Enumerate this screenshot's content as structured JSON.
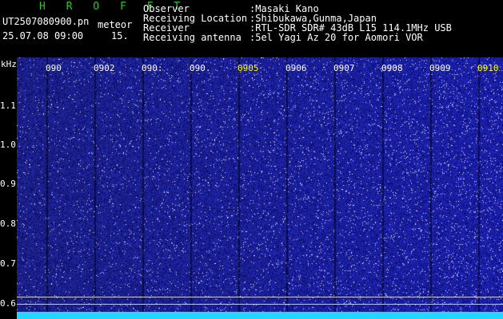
{
  "header": {
    "title": "H R O F F T",
    "file_name": "UT2507080900.pn",
    "mode_label": "meteor",
    "datetime": "25.07.08 09:00",
    "interval": "15.",
    "fields": [
      {
        "label": "Observer",
        "value": ":Masaki Kano"
      },
      {
        "label": "Receiving Location",
        "value": ":Shibukawa,Gunma,Japan"
      },
      {
        "label": "Receiver",
        "value": ":RTL-SDR SDR# 43dB L15 114.1MHz USB"
      },
      {
        "label": "Receiving antenna",
        "value": ":5el Yagi Az 20 for Aomori VOR"
      }
    ]
  },
  "y_axis": {
    "unit": "kHz",
    "ticks": [
      "1.1",
      "1.0",
      "0.9",
      "0.8",
      "0.7",
      "0.6"
    ]
  },
  "x_axis": {
    "labels": [
      "090",
      "0902",
      "090:",
      "090.",
      "0905",
      "0906",
      "0907",
      "0908",
      "0909",
      "0910"
    ]
  },
  "colors": {
    "background": "#000000",
    "title": "#1ec81e",
    "plot_base": "#0a0a80",
    "signal_band": "#20d8ff",
    "label_highlight": "#ffff00"
  }
}
